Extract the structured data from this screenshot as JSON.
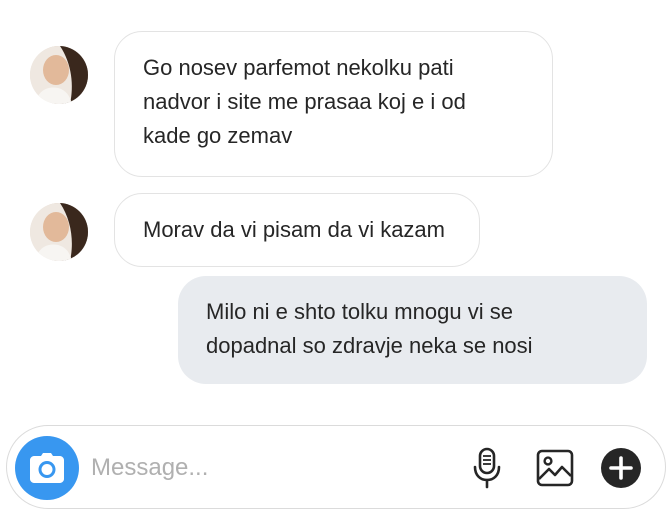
{
  "conversation": {
    "messages": [
      {
        "direction": "incoming",
        "lines": [
          "Go nosev parfemot nekolku pati",
          "nadvor i site me prasaa koj e i od",
          "kade go zemav"
        ]
      },
      {
        "direction": "incoming",
        "lines": [
          "Morav da vi pisam da vi kazam"
        ]
      },
      {
        "direction": "outgoing",
        "lines": [
          "Milo ni e shto tolku mnogu vi se",
          "dopadnal so zdravje neka se nosi"
        ]
      }
    ]
  },
  "composer": {
    "placeholder": "Message...",
    "camera_icon": "camera-icon",
    "mic_icon": "microphone-icon",
    "image_icon": "image-icon",
    "add_icon": "plus-circle-icon"
  },
  "colors": {
    "accent": "#3897f0",
    "outgoing_bubble": "#e8ebef",
    "incoming_border": "#e3e3e3"
  }
}
